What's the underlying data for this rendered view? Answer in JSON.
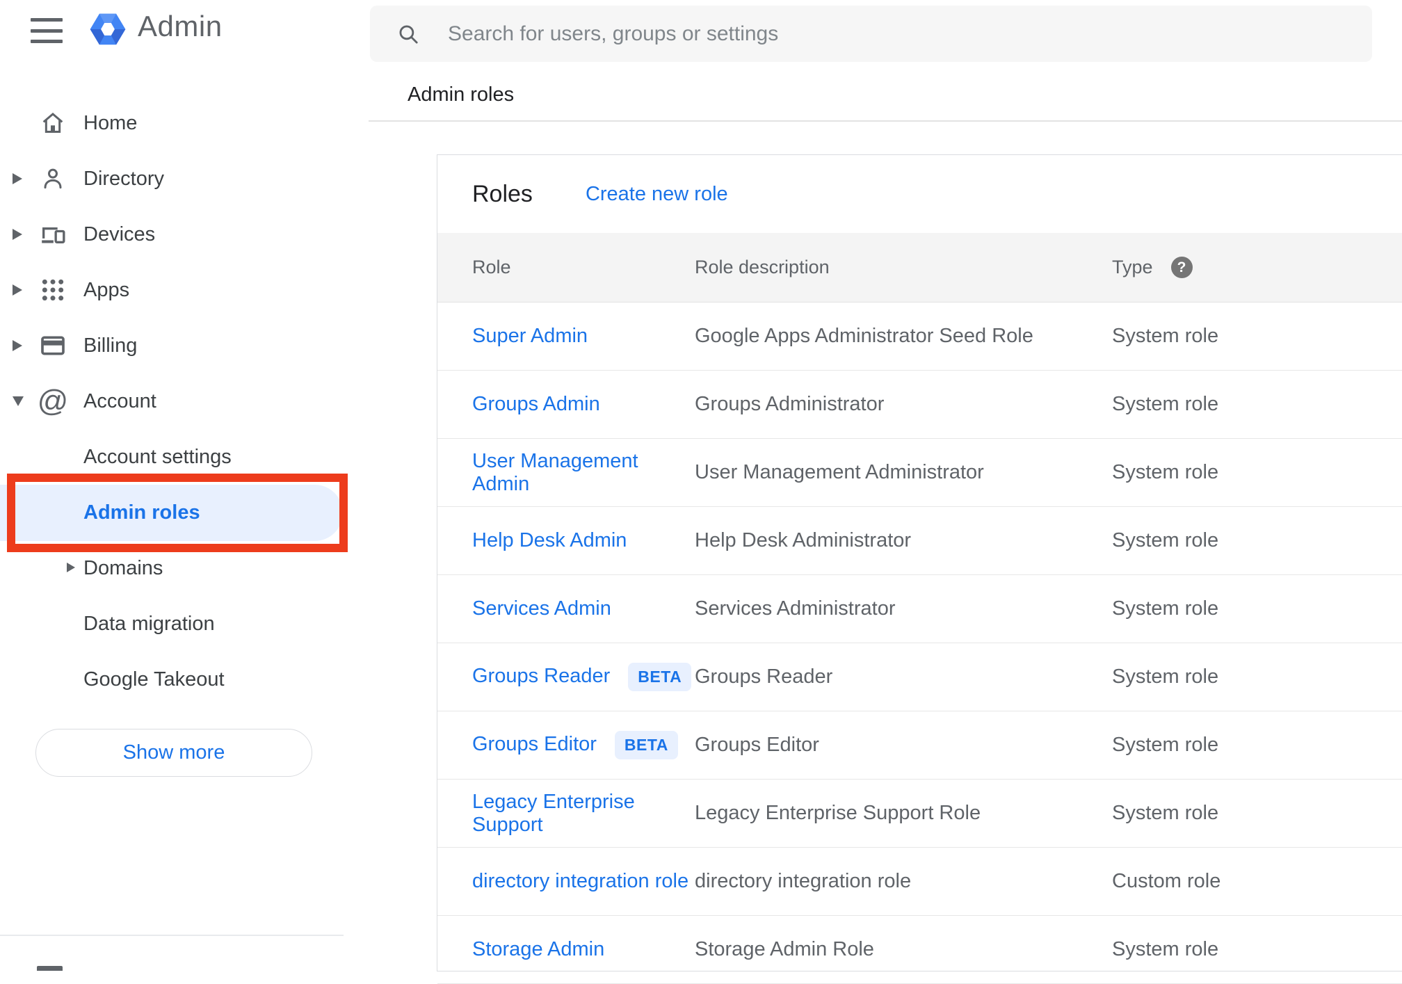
{
  "app": {
    "name": "Admin"
  },
  "colors": {
    "accent": "#1a73e8",
    "text_dark": "#202124",
    "text_gray": "#5f6368",
    "highlight": "#e8f0fe",
    "annotation_red": "#ed3c1c",
    "logo_blue": "#4285f4",
    "logo_blue_dark": "#3367d6"
  },
  "sidebar": {
    "items": [
      {
        "label": "Home",
        "icon": "home-icon",
        "expandable": false
      },
      {
        "label": "Directory",
        "icon": "person-icon",
        "expandable": true
      },
      {
        "label": "Devices",
        "icon": "devices-icon",
        "expandable": true
      },
      {
        "label": "Apps",
        "icon": "apps-grid-icon",
        "expandable": true
      },
      {
        "label": "Billing",
        "icon": "credit-card-icon",
        "expandable": true
      },
      {
        "label": "Account",
        "icon": "at-icon",
        "expanded": true
      }
    ],
    "account_children": [
      {
        "label": "Account settings",
        "selected": false
      },
      {
        "label": "Admin roles",
        "selected": true
      },
      {
        "label": "Domains",
        "expandable": true
      },
      {
        "label": "Data migration",
        "selected": false
      },
      {
        "label": "Google Takeout",
        "selected": false
      }
    ],
    "show_more_label": "Show more"
  },
  "search": {
    "placeholder": "Search for users, groups or settings"
  },
  "breadcrumb": "Admin roles",
  "roles_panel": {
    "title": "Roles",
    "create_link": "Create new role",
    "beta_label": "BETA",
    "columns": {
      "role": "Role",
      "description": "Role description",
      "type": "Type"
    },
    "help_glyph": "?",
    "rows": [
      {
        "role": "Super Admin",
        "beta": false,
        "description": "Google Apps Administrator Seed Role",
        "type": "System role"
      },
      {
        "role": "Groups Admin",
        "beta": false,
        "description": "Groups Administrator",
        "type": "System role"
      },
      {
        "role": "User Management Admin",
        "beta": false,
        "description": "User Management Administrator",
        "type": "System role"
      },
      {
        "role": "Help Desk Admin",
        "beta": false,
        "description": "Help Desk Administrator",
        "type": "System role"
      },
      {
        "role": "Services Admin",
        "beta": false,
        "description": "Services Administrator",
        "type": "System role"
      },
      {
        "role": "Groups Reader",
        "beta": true,
        "description": "Groups Reader",
        "type": "System role"
      },
      {
        "role": "Groups Editor",
        "beta": true,
        "description": "Groups Editor",
        "type": "System role"
      },
      {
        "role": "Legacy Enterprise Support",
        "beta": false,
        "description": "Legacy Enterprise Support Role",
        "type": "System role"
      },
      {
        "role": "directory integration role",
        "beta": false,
        "description": "directory integration role",
        "type": "Custom role"
      },
      {
        "role": "Storage Admin",
        "beta": false,
        "description": "Storage Admin Role",
        "type": "System role"
      }
    ]
  }
}
